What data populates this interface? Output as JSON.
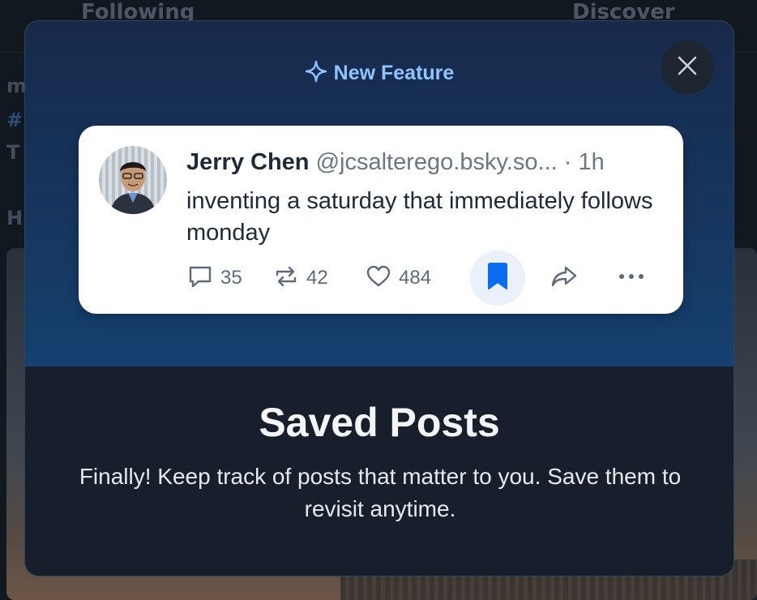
{
  "background": {
    "tabs": [
      "Following",
      "Discover"
    ],
    "side_letters": [
      "m",
      "#",
      "T",
      "H"
    ]
  },
  "modal": {
    "close_label": "Close",
    "badge": {
      "icon": "sparkle-icon",
      "label": "New Feature"
    },
    "post": {
      "author_name": "Jerry Chen",
      "author_handle": "@jcsalterego.bsky.so...",
      "separator": "·",
      "time": "1h",
      "text": "inventing a saturday that immediately follows monday",
      "replies": "35",
      "reposts": "42",
      "likes": "484"
    },
    "title": "Saved Posts",
    "description": "Finally! Keep track of posts that matter to you. Save them to revisit anytime."
  },
  "colors": {
    "accent": "#8fc4ff",
    "bookmark": "#0a6cf0"
  }
}
